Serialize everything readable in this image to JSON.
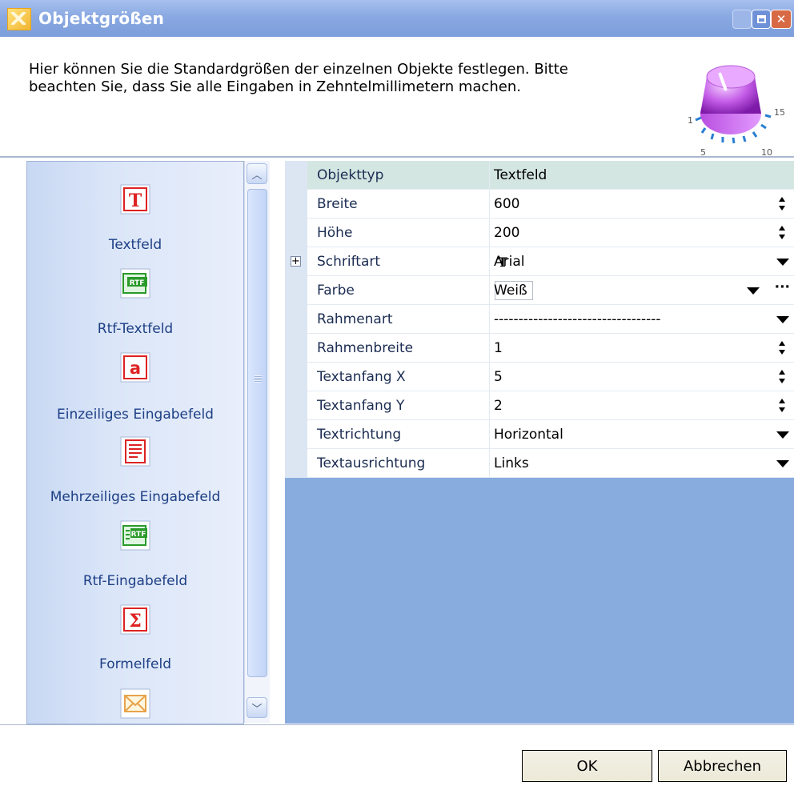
{
  "window": {
    "title": "Objektgrößen",
    "icon": "app-icon",
    "controls": [
      "minimize-icon",
      "maximize-icon",
      "close-icon"
    ]
  },
  "info": {
    "text": "Hier können Sie die Standardgrößen der einzelnen Objekte festlegen. Bitte beachten Sie, dass Sie alle Eingaben in Zehntelmillimetern machen.",
    "graphic": "knob-icon",
    "knob_scale": [
      "1",
      "5",
      "10",
      "15"
    ]
  },
  "objects": [
    {
      "label": "Textfeld",
      "icon": "textfield-icon"
    },
    {
      "label": "Rtf-Textfeld",
      "icon": "rtf-textfield-icon"
    },
    {
      "label": "Einzeiliges Eingabefeld",
      "icon": "single-line-input-icon"
    },
    {
      "label": "Mehrzeiliges Eingabefeld",
      "icon": "multi-line-input-icon"
    },
    {
      "label": "Rtf-Eingabefeld",
      "icon": "rtf-input-icon"
    },
    {
      "label": "Formelfeld",
      "icon": "formula-field-icon"
    },
    {
      "label": "",
      "icon": "envelope-icon"
    }
  ],
  "properties": [
    {
      "name": "Objekttyp",
      "value": "Textfeld"
    },
    {
      "name": "Breite",
      "value": "600"
    },
    {
      "name": "Höhe",
      "value": "200"
    },
    {
      "name": "Schriftart",
      "value": "Arial"
    },
    {
      "name": "Farbe",
      "value": "Weiß"
    },
    {
      "name": "Rahmenart",
      "value": "----------------------------------"
    },
    {
      "name": "Rahmenbreite",
      "value": "1"
    },
    {
      "name": "Textanfang X",
      "value": "5"
    },
    {
      "name": "Textanfang Y",
      "value": "2"
    },
    {
      "name": "Textrichtung",
      "value": "Horizontal"
    },
    {
      "name": "Textausrichtung",
      "value": "Links"
    }
  ],
  "buttons": {
    "ok": "OK",
    "cancel": "Abbrechen"
  },
  "colors": {
    "titlebar": "#7b9ddb",
    "grid_background": "#89acdf",
    "header_row": "#d4e6e2",
    "close_button": "#d76a45"
  }
}
